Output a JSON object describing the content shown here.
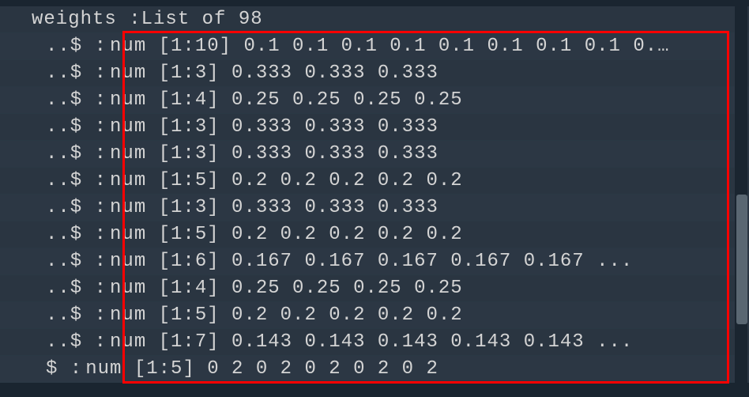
{
  "header": {
    "text": "weights :List of 98"
  },
  "rows": [
    {
      "prefix": "..$ :",
      "content": "num [1:10] 0.1 0.1 0.1 0.1 0.1 0.1 0.1 0.1 0.…"
    },
    {
      "prefix": "..$ :",
      "content": "num [1:3] 0.333 0.333 0.333"
    },
    {
      "prefix": "..$ :",
      "content": "num [1:4] 0.25 0.25 0.25 0.25"
    },
    {
      "prefix": "..$ :",
      "content": "num [1:3] 0.333 0.333 0.333"
    },
    {
      "prefix": "..$ :",
      "content": "num [1:3] 0.333 0.333 0.333"
    },
    {
      "prefix": "..$ :",
      "content": "num [1:5] 0.2 0.2 0.2 0.2 0.2"
    },
    {
      "prefix": "..$ :",
      "content": "num [1:3] 0.333 0.333 0.333"
    },
    {
      "prefix": "..$ :",
      "content": "num [1:5] 0.2 0.2 0.2 0.2 0.2"
    },
    {
      "prefix": "..$ :",
      "content": "num [1:6] 0.167 0.167 0.167 0.167 0.167 ..."
    },
    {
      "prefix": "..$ :",
      "content": "num [1:4] 0.25 0.25 0.25 0.25"
    },
    {
      "prefix": "..$ :",
      "content": "num [1:5] 0.2 0.2 0.2 0.2 0.2"
    },
    {
      "prefix": "..$ :",
      "content": "num [1:7] 0.143 0.143 0.143 0.143 0.143 ..."
    },
    {
      "prefix": "  $ :",
      "content": "num [1:5] 0 2 0 2 0 2 0 2 0 2"
    }
  ]
}
